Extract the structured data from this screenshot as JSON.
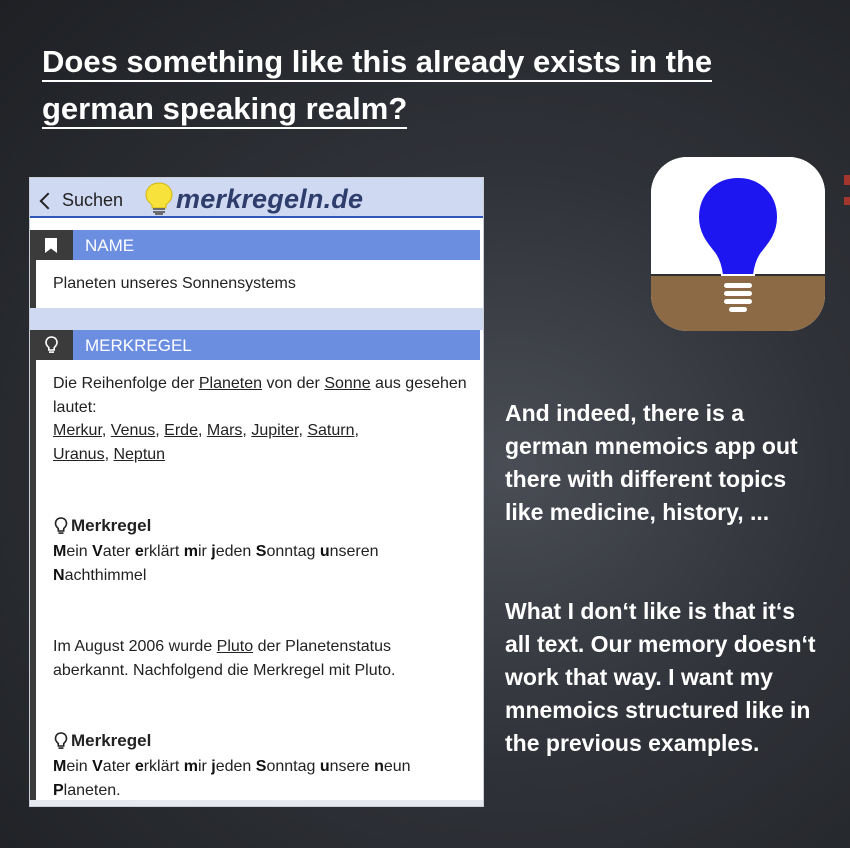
{
  "slide": {
    "title": "Does something like this already exists in the german speaking realm?",
    "text_color": "#ffffff"
  },
  "app": {
    "back_label": "Suchen",
    "logo_text": "merkregeln.de",
    "section_name": {
      "label": "NAME",
      "icon": "bookmark-icon",
      "value": "Planeten unseres Sonnensystems"
    },
    "section_merkregel": {
      "label": "MERKREGEL",
      "icon": "lightbulb-icon",
      "intro_1": "Die Reihenfolge der",
      "planeten_link": "Planeten",
      "intro_2": "von der",
      "sonne_link": "Sonne",
      "intro_3": "aus gesehen lautet:",
      "planets": [
        "Merkur",
        "Venus",
        "Erde",
        "Mars",
        "Jupiter",
        "Saturn",
        "Uranus",
        "Neptun"
      ]
    },
    "mnemonic_1": {
      "heading": "Merkregel",
      "text": "Mein Vater erklärt mir jeden Sonntag unseren Nachthimmel"
    },
    "pluto_note": {
      "text_1": "Im August 2006 wurde",
      "pluto_link": "Pluto",
      "text_2": "der Planetenstatus aberkannt. Nachfolgend die Merkregel mit Pluto."
    },
    "mnemonic_2": {
      "heading": "Merkregel",
      "text": "Mein Vater erklärt mir jeden Sonntag unsere neun Planeten."
    },
    "colors": {
      "header_bg": "#cfd9f2",
      "section_bar": "#6b8ee0",
      "icon_box": "#3b3b3b",
      "logo": "#2e3d6b",
      "bulb": "#f7e23b"
    }
  },
  "app_icon": {
    "icon": "blue-lightbulb-icon",
    "bulb_color": "#1d16f0",
    "ground_color": "#8b6a45"
  },
  "description": {
    "para_1": "And indeed, there is a german mnemoics app out there with different topics like medicine, history, ...",
    "para_2": "What I don‘t like is that it‘s all text. Our memory doesn‘t work that way. I want my mnemoics structured like in the previous examples."
  }
}
